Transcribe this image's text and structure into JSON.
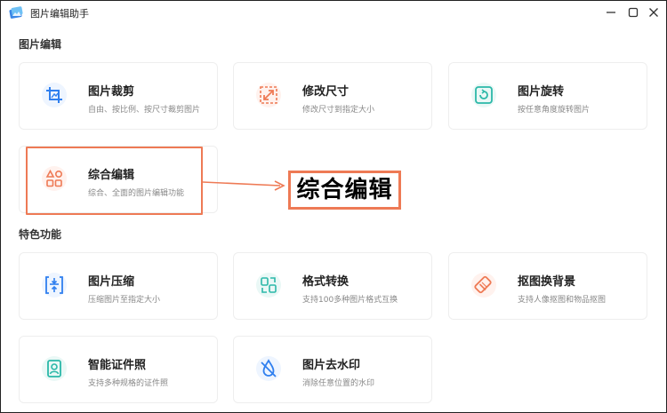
{
  "window": {
    "title": "图片编辑助手",
    "controls": {
      "minimize": "minimize",
      "maximize": "maximize",
      "close": "close"
    }
  },
  "sections": {
    "editing": "图片编辑",
    "features": "特色功能"
  },
  "cards": {
    "crop": {
      "title": "图片裁剪",
      "desc": "自由、按比例、按尺寸裁剪图片",
      "icon": "crop-icon"
    },
    "resize": {
      "title": "修改尺寸",
      "desc": "修改尺寸到指定大小",
      "icon": "resize-icon"
    },
    "rotate": {
      "title": "图片旋转",
      "desc": "按任意角度旋转图片",
      "icon": "rotate-icon"
    },
    "composite": {
      "title": "综合编辑",
      "desc": "综合、全面的图片编辑功能",
      "icon": "shapes-icon"
    },
    "compress": {
      "title": "图片压缩",
      "desc": "压缩图片至指定大小",
      "icon": "compress-icon"
    },
    "convert": {
      "title": "格式转换",
      "desc": "支持100多种图片格式互换",
      "icon": "convert-icon"
    },
    "cutout": {
      "title": "抠图换背景",
      "desc": "支持人像抠图和物品抠图",
      "icon": "eraser-icon"
    },
    "idphoto": {
      "title": "智能证件照",
      "desc": "支持多种规格的证件照",
      "icon": "portrait-icon"
    },
    "watermark": {
      "title": "图片去水印",
      "desc": "消除任意位置的水印",
      "icon": "no-water-drop-icon"
    }
  },
  "annotation": {
    "label": "综合编辑"
  },
  "colors": {
    "accent_blue": "#2f7fef",
    "accent_orange": "#ee7a55",
    "accent_green": "#2bb8a8",
    "icon_bg_blue": "#eef5ff",
    "icon_bg_orange": "#fff2ee",
    "icon_bg_green": "#eaf8f6"
  }
}
